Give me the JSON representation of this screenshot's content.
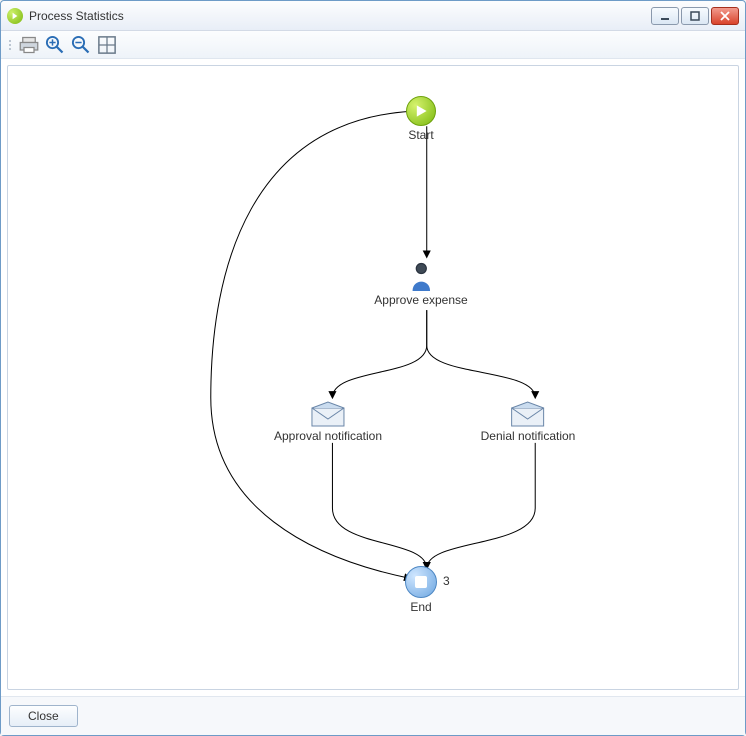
{
  "window": {
    "title": "Process Statistics"
  },
  "toolbar": {
    "print": "Print",
    "zoom_in": "Zoom In",
    "zoom_out": "Zoom Out",
    "fit": "Fit to Window"
  },
  "nodes": {
    "start": {
      "label": "Start"
    },
    "approve_expense": {
      "label": "Approve expense"
    },
    "approval_notification": {
      "label": "Approval notification"
    },
    "denial_notification": {
      "label": "Denial notification"
    },
    "end": {
      "label": "End",
      "count": "3"
    }
  },
  "footer": {
    "close": "Close"
  }
}
